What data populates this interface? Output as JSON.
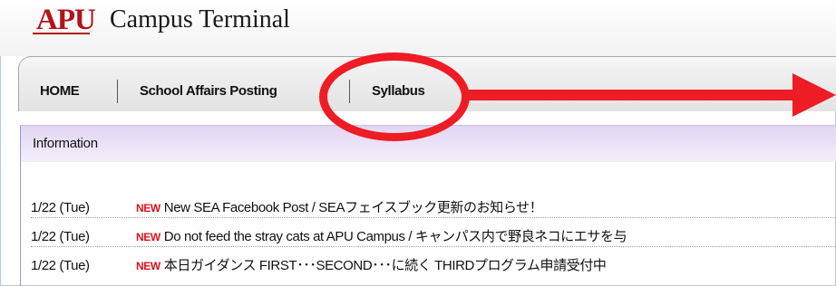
{
  "header": {
    "logo_mark": "APU",
    "logo_text": "Campus Terminal"
  },
  "nav": {
    "items": [
      {
        "label": "HOME"
      },
      {
        "label": "School Affairs Posting"
      },
      {
        "label": "Syllabus"
      }
    ]
  },
  "info": {
    "title": "Information",
    "new_badge": "NEW",
    "items": [
      {
        "date": "1/22 (Tue)",
        "title": "New SEA Facebook Post / SEAフェイスブック更新のお知らせ！"
      },
      {
        "date": "1/22 (Tue)",
        "title": "Do not feed the stray cats at APU Campus / キャンパス内で野良ネコにエサを与"
      },
      {
        "date": "1/22 (Tue)",
        "title": "本日ガイダンス FIRST･･･SECOND･･･に続く THIRDプログラム申請受付中"
      }
    ]
  },
  "annotation": {
    "color": "#ee1c24",
    "highlighted_item": "Syllabus"
  }
}
